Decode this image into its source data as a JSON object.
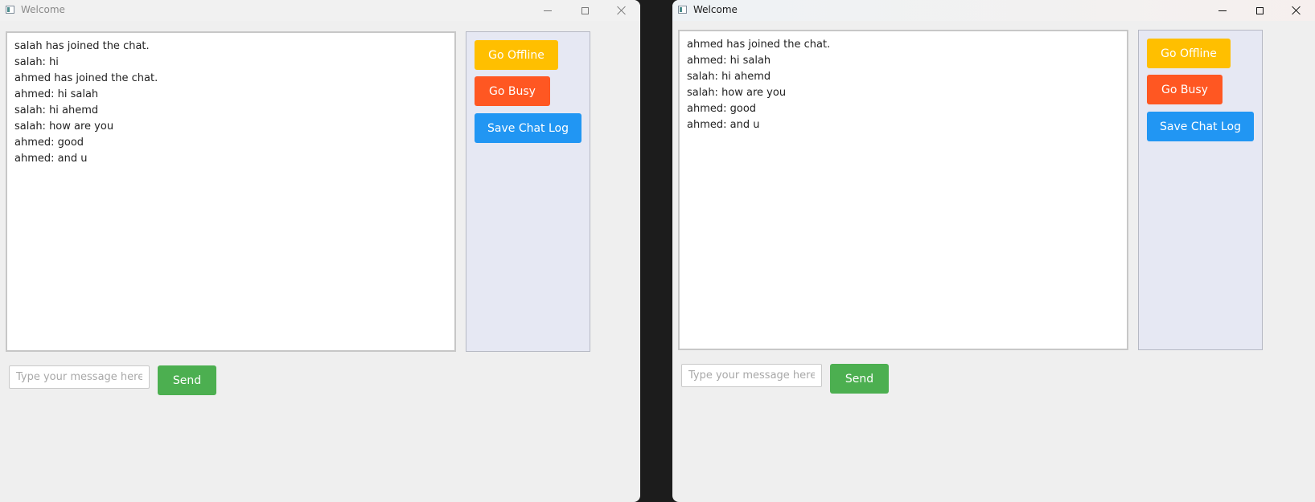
{
  "windows": [
    {
      "title": "Welcome",
      "chat_log": [
        "salah has joined the chat.",
        "salah: hi",
        "ahmed has joined the chat.",
        "ahmed: hi salah",
        "salah: hi ahemd",
        "salah: how are you",
        "ahmed: good",
        "ahmed: and u"
      ],
      "buttons": {
        "go_offline": "Go Offline",
        "go_busy": "Go Busy",
        "save_chat_log": "Save Chat Log",
        "send": "Send"
      },
      "input": {
        "placeholder": "Type your message here...",
        "value": ""
      }
    },
    {
      "title": "Welcome",
      "chat_log": [
        "ahmed has joined the chat.",
        "ahmed: hi salah",
        "salah: hi ahemd",
        "salah: how are you",
        "ahmed: good",
        "ahmed: and u"
      ],
      "buttons": {
        "go_offline": "Go Offline",
        "go_busy": "Go Busy",
        "save_chat_log": "Save Chat Log",
        "send": "Send"
      },
      "input": {
        "placeholder": "Type your message here...",
        "value": ""
      }
    }
  ],
  "colors": {
    "go_offline": "#ffbf00",
    "go_busy": "#ff5722",
    "save_chat_log": "#2196f3",
    "send": "#4caf50",
    "side_panel": "#e6e8f3",
    "window_bg": "#efefef"
  },
  "icons": {
    "app": "app-window-icon",
    "minimize": "minimize-icon",
    "maximize": "maximize-icon",
    "close": "close-icon"
  }
}
